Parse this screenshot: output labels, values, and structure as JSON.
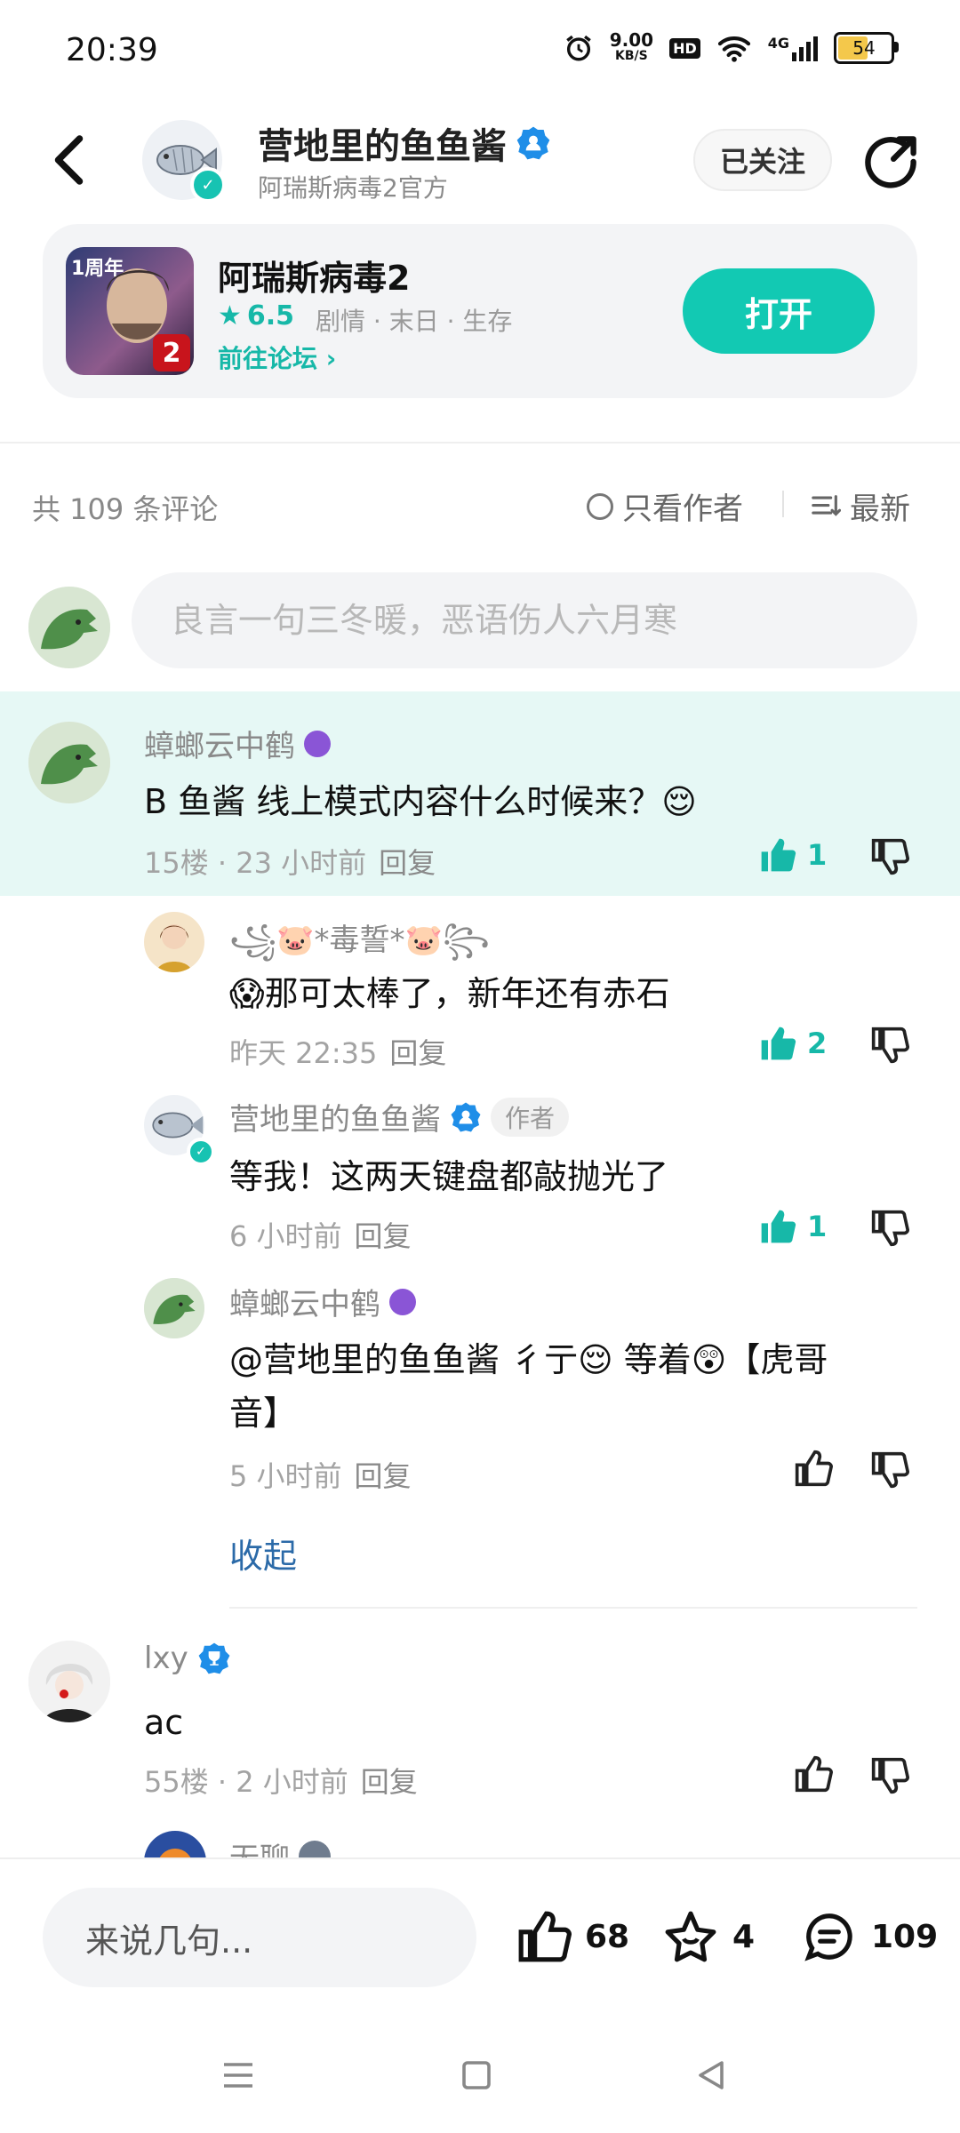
{
  "status": {
    "time": "20:39",
    "net_speed_top": "9.00",
    "net_speed_bottom": "KB/S",
    "hd": "HD",
    "network": "4G",
    "battery": "54"
  },
  "header": {
    "author_name": "营地里的鱼鱼酱",
    "author_sub": "阿瑞斯病毒2官方",
    "follow_label": "已关注"
  },
  "game": {
    "title": "阿瑞斯病毒2",
    "rating": "6.5",
    "tags": "剧情 · 末日 · 生存",
    "forum_link": "前往论坛 ›",
    "open_label": "打开",
    "icon_badge_text": "1周年",
    "icon_number": "2"
  },
  "comments_header": {
    "count": "共 109 条评论",
    "only_author": "只看作者",
    "sort": "最新"
  },
  "composer": {
    "placeholder": "良言一句三冬暖，恶语伤人六月寒"
  },
  "comments": [
    {
      "user": "蟑螂云中鹤",
      "text": "B 鱼酱 线上模式内容什么时候来？😌",
      "floor": "15楼 · 23 小时前",
      "reply": "回复",
      "likes": "1",
      "replies": [
        {
          "user": "꧁🐷*毒誓*🐷꧂",
          "text": "😱那可太棒了，新年还有赤石",
          "time": "昨天 22:35",
          "reply": "回复",
          "likes": "2"
        },
        {
          "user": "营地里的鱼鱼酱",
          "badge": "作者",
          "text": "等我！这两天键盘都敲抛光了",
          "time": "6 小时前",
          "reply": "回复",
          "likes": "1"
        },
        {
          "user": "蟑螂云中鹤",
          "text_line1": "@营地里的鱼鱼酱 彳亍😌 等着😲【虎哥",
          "text_line2": "音】",
          "time": "5 小时前",
          "reply": "回复"
        }
      ],
      "collapse": "收起"
    },
    {
      "user": "lxy",
      "text": "ac",
      "floor": "55楼 · 2 小时前",
      "reply": "回复"
    },
    {
      "user": "无聊"
    }
  ],
  "bottom": {
    "say_placeholder": "来说几句...",
    "likes": "68",
    "favorites": "4",
    "comments": "109"
  },
  "colors": {
    "accent": "#12c9b3",
    "highlight": "#e6f8f5",
    "link": "#2b6aa8"
  }
}
